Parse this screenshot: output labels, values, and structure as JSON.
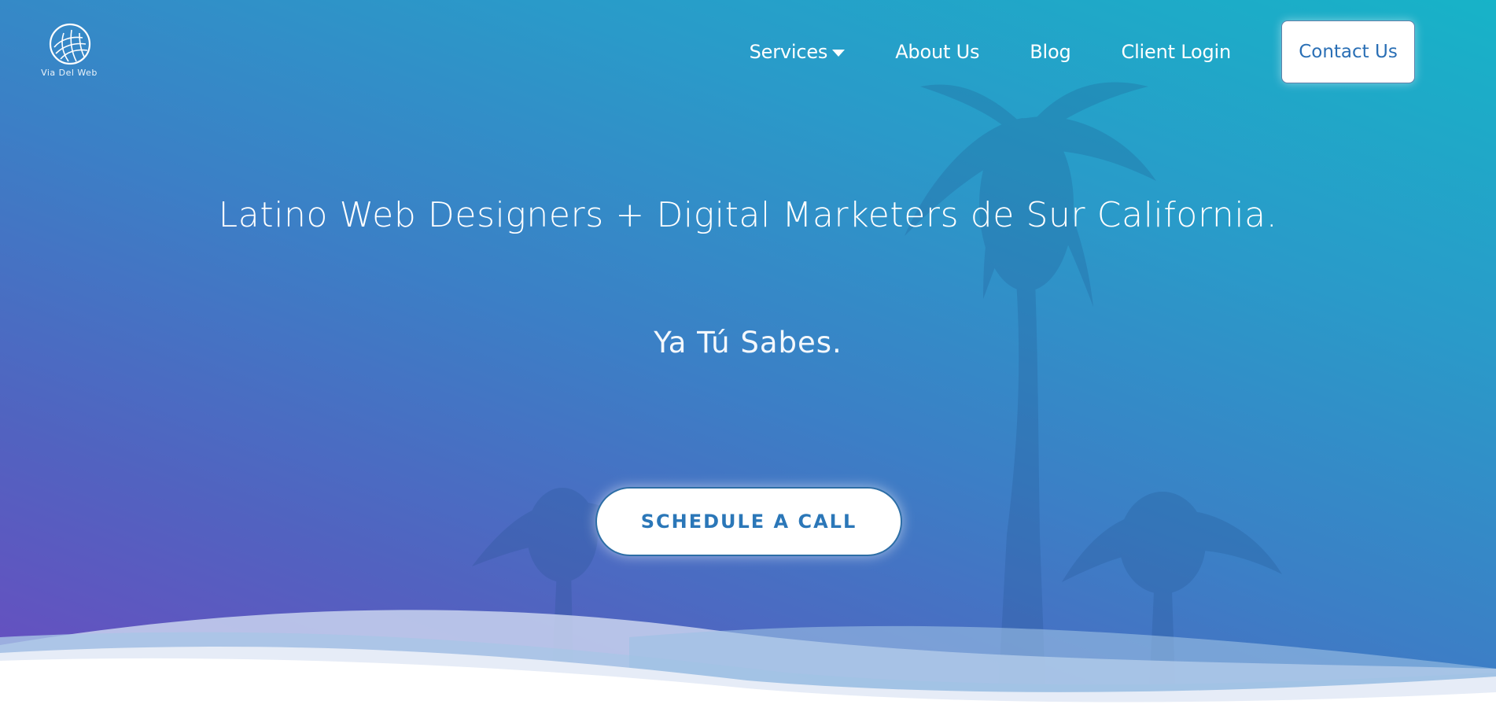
{
  "brand": {
    "logo_text": "Via Del Web",
    "logo_icon": "globe-icon"
  },
  "nav": {
    "items": [
      {
        "label": "Services",
        "has_dropdown": true
      },
      {
        "label": "About Us"
      },
      {
        "label": "Blog"
      },
      {
        "label": "Client Login"
      }
    ],
    "contact_label": "Contact Us"
  },
  "hero": {
    "headline": "Latino Web Designers + Digital Marketers de Sur California.",
    "subheadline": "Ya Tú Sabes.",
    "cta_label": "SCHEDULE A CALL"
  },
  "colors": {
    "gradient_top_right": "#17b3c8",
    "gradient_bottom_left": "#6a4cc0",
    "accent": "#2b77b8",
    "white": "#ffffff"
  }
}
